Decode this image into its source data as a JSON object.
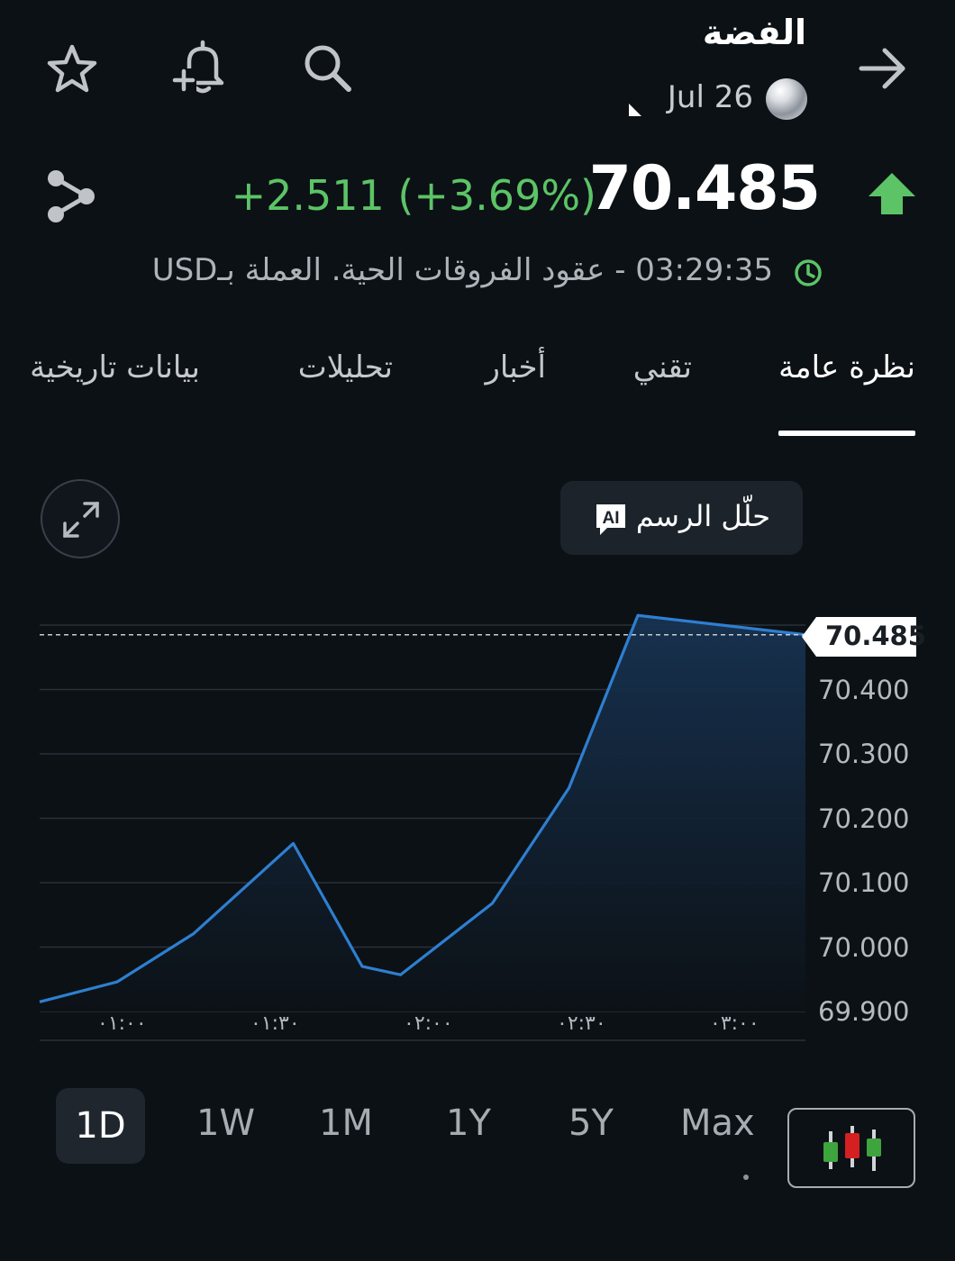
{
  "header": {
    "title": "الفضة",
    "date": "Jul 26",
    "icons": [
      "star-icon",
      "bell-plus-icon",
      "search-icon",
      "arrow-right-icon",
      "share-icon"
    ]
  },
  "quote": {
    "price": "70.485",
    "change": "+2.511 (+3.69%)",
    "direction": "up",
    "change_color": "#5cc466",
    "time": "03:29:35",
    "status_text": "- عقود الفروقات الحية. العملة بـUSD"
  },
  "tabs": [
    {
      "label": "نظرة عامة",
      "active": true
    },
    {
      "label": "تقني",
      "active": false
    },
    {
      "label": "أخبار",
      "active": false
    },
    {
      "label": "تحليلات",
      "active": false
    },
    {
      "label": "بيانات تاريخية",
      "active": false
    }
  ],
  "chart_toolbar": {
    "ai_button_label": "حلّل الرسم",
    "ai_badge": "AI"
  },
  "chart_data": {
    "type": "area",
    "line_color": "#2e7fd0",
    "x_tick_labels": [
      "٠١:٠٠",
      "٠١:٣٠",
      "٠٢:٠٠",
      "٠٢:٣٠",
      "٠٣:٠٠"
    ],
    "y_tick_labels": [
      "70.400",
      "70.300",
      "70.200",
      "70.100",
      "70.000",
      "69.900"
    ],
    "ylim": [
      69.9,
      70.5
    ],
    "last_price_label": "70.485",
    "last_price": 70.485,
    "points": [
      [
        0.72,
        69.915
      ],
      [
        1.0,
        69.946
      ],
      [
        1.5,
        70.021
      ],
      [
        2.15,
        70.161
      ],
      [
        2.6,
        69.97
      ],
      [
        2.85,
        69.957
      ],
      [
        3.45,
        70.068
      ],
      [
        3.95,
        70.247
      ],
      [
        4.4,
        70.515
      ],
      [
        4.95,
        70.485
      ]
    ]
  },
  "ranges": [
    {
      "label": "1D",
      "active": true
    },
    {
      "label": "1W",
      "active": false
    },
    {
      "label": "1M",
      "active": false
    },
    {
      "label": "1Y",
      "active": false
    },
    {
      "label": "5Y",
      "active": false
    },
    {
      "label": "Max",
      "active": false
    }
  ]
}
